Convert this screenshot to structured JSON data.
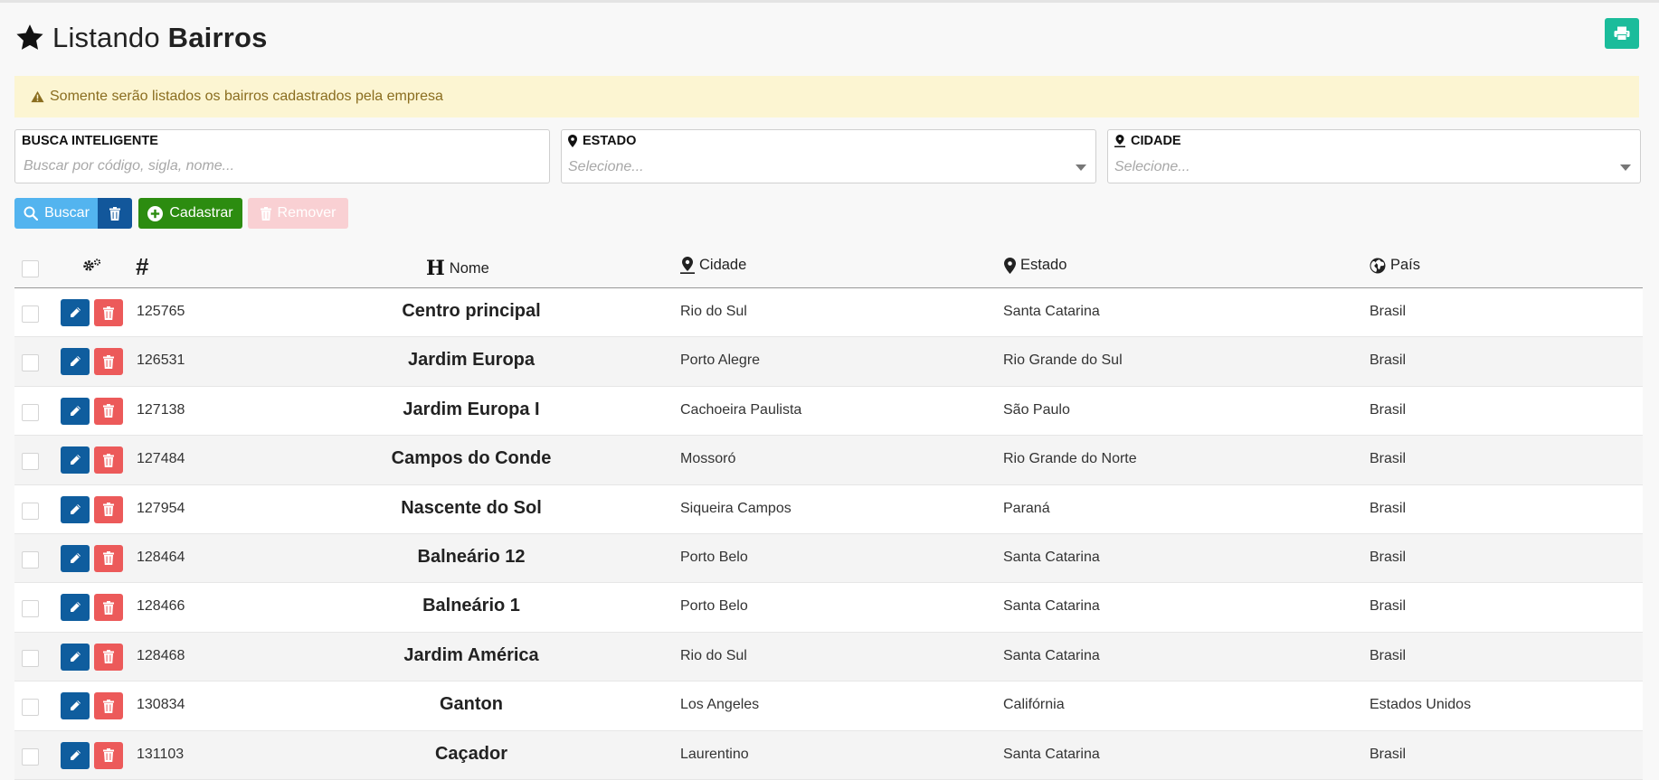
{
  "header": {
    "title_prefix": "Listando",
    "title_bold": "Bairros"
  },
  "alert": {
    "text": "Somente serão listados os bairros cadastrados pela empresa"
  },
  "filters": {
    "busca": {
      "label": "BUSCA INTELIGENTE",
      "placeholder": "Buscar por código, sigla, nome..."
    },
    "estado": {
      "label": "ESTADO",
      "placeholder": "Selecione..."
    },
    "cidade": {
      "label": "CIDADE",
      "placeholder": "Selecione..."
    }
  },
  "buttons": {
    "buscar": "Buscar",
    "cadastrar": "Cadastrar",
    "remover": "Remover"
  },
  "table": {
    "columns": {
      "id": "#",
      "nome": "Nome",
      "cidade": "Cidade",
      "estado": "Estado",
      "pais": "País"
    },
    "rows": [
      {
        "id": "125765",
        "nome": "Centro principal",
        "cidade": "Rio do Sul",
        "estado": "Santa Catarina",
        "pais": "Brasil"
      },
      {
        "id": "126531",
        "nome": "Jardim Europa",
        "cidade": "Porto Alegre",
        "estado": "Rio Grande do Sul",
        "pais": "Brasil"
      },
      {
        "id": "127138",
        "nome": "Jardim Europa I",
        "cidade": "Cachoeira Paulista",
        "estado": "São Paulo",
        "pais": "Brasil"
      },
      {
        "id": "127484",
        "nome": "Campos do Conde",
        "cidade": "Mossoró",
        "estado": "Rio Grande do Norte",
        "pais": "Brasil"
      },
      {
        "id": "127954",
        "nome": "Nascente do Sol",
        "cidade": "Siqueira Campos",
        "estado": "Paraná",
        "pais": "Brasil"
      },
      {
        "id": "128464",
        "nome": "Balneário 12",
        "cidade": "Porto Belo",
        "estado": "Santa Catarina",
        "pais": "Brasil"
      },
      {
        "id": "128466",
        "nome": "Balneário 1",
        "cidade": "Porto Belo",
        "estado": "Santa Catarina",
        "pais": "Brasil"
      },
      {
        "id": "128468",
        "nome": "Jardim América",
        "cidade": "Rio do Sul",
        "estado": "Santa Catarina",
        "pais": "Brasil"
      },
      {
        "id": "130834",
        "nome": "Ganton",
        "cidade": "Los Angeles",
        "estado": "Califórnia",
        "pais": "Estados Unidos"
      },
      {
        "id": "131103",
        "nome": "Caçador",
        "cidade": "Laurentino",
        "estado": "Santa Catarina",
        "pais": "Brasil"
      }
    ]
  },
  "colors": {
    "buscar": "#53b4ef",
    "clear": "#12579b",
    "cadastrar": "#2c8c10",
    "remover": "#f9d0d3",
    "print": "#1bbc9b",
    "edit": "#0f5d9e",
    "delete": "#ec5a5a",
    "alert_bg": "#fcf5d2",
    "alert_text": "#8a6d1f"
  },
  "icons": {
    "header": "star-icon",
    "print": "print-icon",
    "alert": "warning-icon",
    "estado_label": "map-marker-icon",
    "cidade_label": "map-pin-icon",
    "buscar": "search-icon",
    "clear": "trash-icon",
    "cadastrar": "plus-circle-icon",
    "remover": "trash-icon",
    "col_actions": "gears-icon",
    "col_nome": "header-icon",
    "col_cidade": "map-pin-icon",
    "col_estado": "map-marker-icon",
    "col_pais": "globe-icon",
    "row_edit": "pencil-icon",
    "row_delete": "trash-icon"
  }
}
